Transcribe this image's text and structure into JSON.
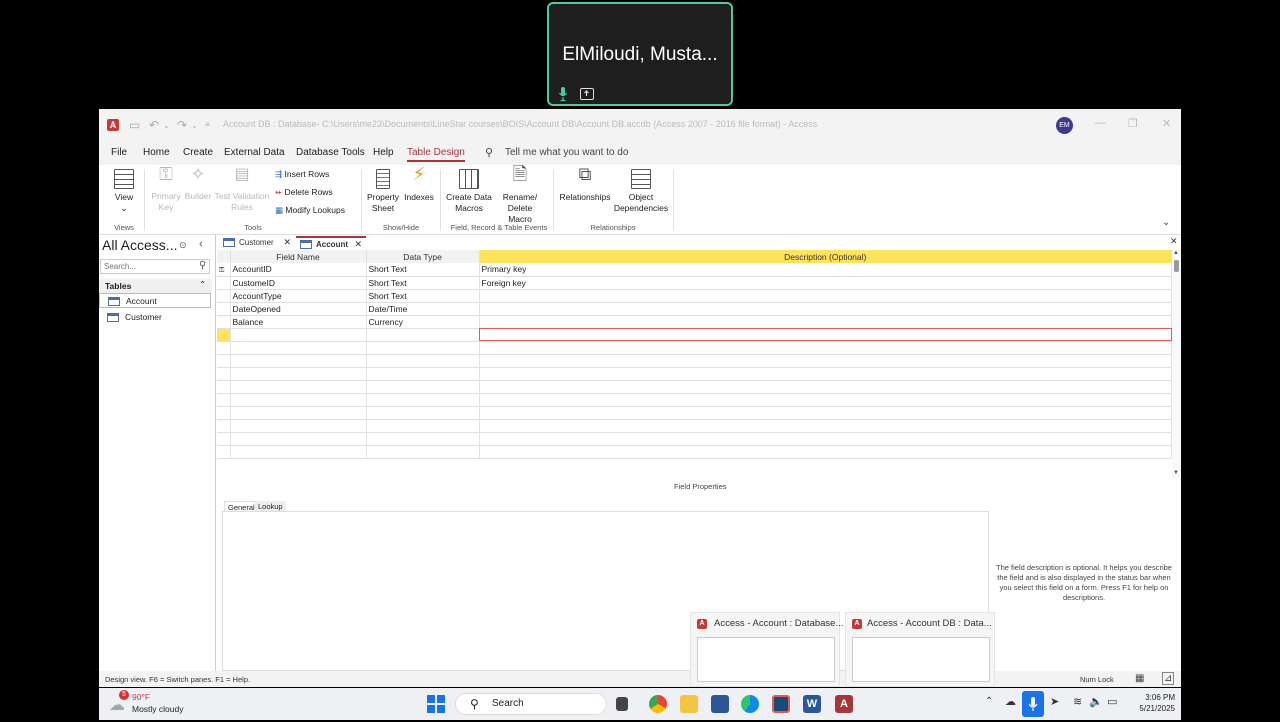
{
  "meeting": {
    "participant_name": "ElMiloudi, Musta...",
    "icons": [
      "mic-icon",
      "share-screen-icon"
    ]
  },
  "window": {
    "title": "Account DB : Database- C:\\Users\\me23\\Documents\\LineStar courses\\BOIS\\Account DB\\Account DB.accdb (Access 2007 - 2016 file format) - Access",
    "user_initials": "EM"
  },
  "menu": {
    "items": [
      "File",
      "Home",
      "Create",
      "External Data",
      "Database Tools",
      "Help",
      "Table Design"
    ],
    "active": "Table Design",
    "tell_me": "Tell me what you want to do"
  },
  "ribbon": {
    "view": "View",
    "primary_key": "Primary Key",
    "builder": "Builder",
    "test_validation": "Test Validation Rules",
    "insert_rows": "Insert Rows",
    "delete_rows": "Delete Rows",
    "modify_lookups": "Modify Lookups",
    "property_sheet": "Property Sheet",
    "indexes": "Indexes",
    "create_data_macros": "Create Data Macros",
    "rename_delete_macro": "Rename/ Delete Macro",
    "relationships": "Relationships",
    "object_dependencies": "Object Dependencies",
    "groups": {
      "views": "Views",
      "tools": "Tools",
      "show_hide": "Show/Hide",
      "field_events": "Field, Record & Table Events",
      "relationships": "Relationships"
    }
  },
  "nav": {
    "title": "All Access...",
    "search_placeholder": "Search...",
    "section": "Tables",
    "items": [
      "Account",
      "Customer"
    ],
    "selected": "Account"
  },
  "doc_tabs": [
    {
      "label": "Customer",
      "active": false
    },
    {
      "label": "Account",
      "active": true
    }
  ],
  "design_grid": {
    "headers": [
      "Field Name",
      "Data Type",
      "Description (Optional)"
    ],
    "rows": [
      {
        "field": "AccountID",
        "type": "Short Text",
        "description": "Primary key",
        "primary": true
      },
      {
        "field": "CustomeID",
        "type": "Short Text",
        "description": "Foreign key"
      },
      {
        "field": "AccountType",
        "type": "Short Text",
        "description": ""
      },
      {
        "field": "DateOpened",
        "type": "Date/Time",
        "description": ""
      },
      {
        "field": "Balance",
        "type": "Currency",
        "description": ""
      }
    ]
  },
  "field_properties": {
    "label": "Field Properties",
    "tabs": [
      "General",
      "Lookup"
    ],
    "help": "The field description is optional. It helps you describe the field and is also displayed in the status bar when you select this field on a form. Press F1 for help on descriptions."
  },
  "status": {
    "text": "Design view.  F6 = Switch panes.  F1 = Help.",
    "numlock": "Num Lock"
  },
  "thumbnails": [
    "Access - Account : Database...",
    "Access - Account DB : Data..."
  ],
  "taskbar": {
    "weather_badge": "5",
    "temperature": "90°F",
    "condition": "Mostly cloudy",
    "search": "Search",
    "time": "3:06 PM",
    "date": "5/21/2025"
  }
}
